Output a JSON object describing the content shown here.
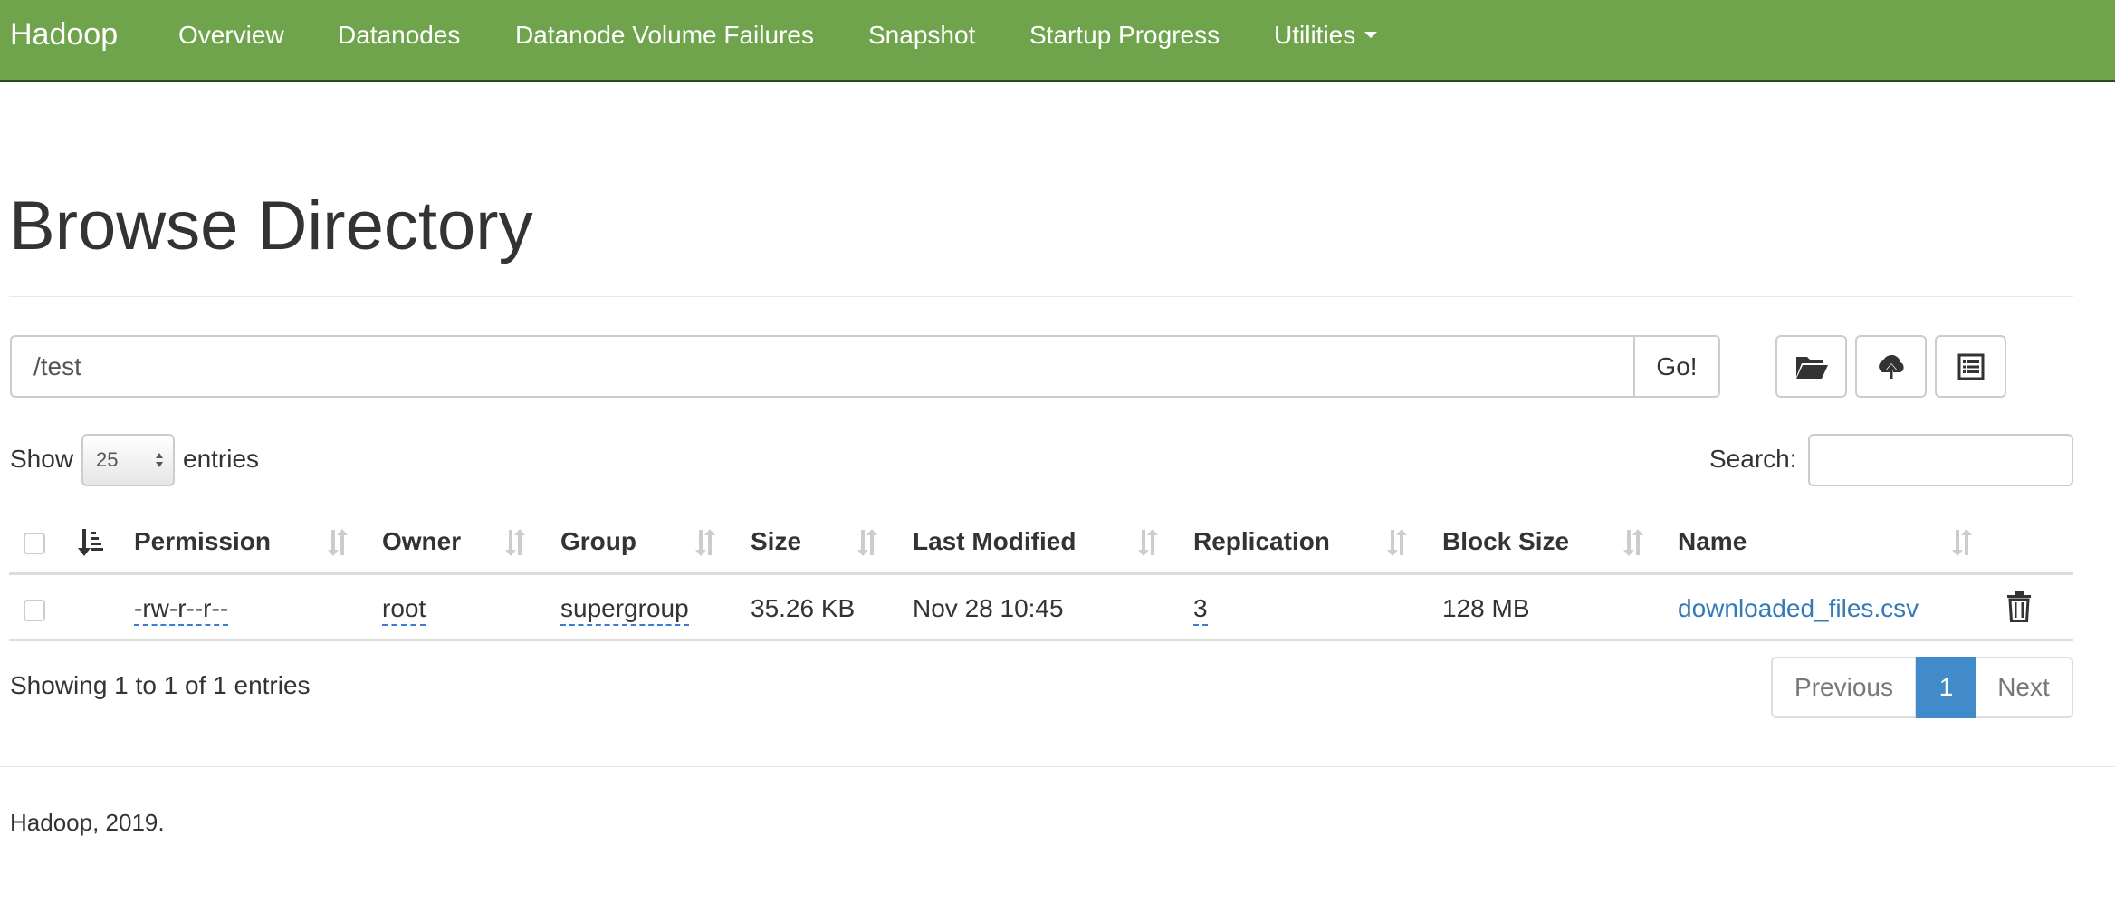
{
  "navbar": {
    "brand": "Hadoop",
    "items": [
      {
        "label": "Overview"
      },
      {
        "label": "Datanodes"
      },
      {
        "label": "Datanode Volume Failures"
      },
      {
        "label": "Snapshot"
      },
      {
        "label": "Startup Progress"
      },
      {
        "label": "Utilities"
      }
    ],
    "background_color": "#6fa44c"
  },
  "page": {
    "title": "Browse Directory"
  },
  "path_bar": {
    "value": "/test",
    "go_label": "Go!",
    "tool_icons": [
      "folder-open-icon",
      "cloud-upload-icon",
      "list-alt-icon"
    ]
  },
  "table_controls": {
    "show_label": "Show",
    "page_length": "25",
    "entries_label": "entries",
    "search_label": "Search:",
    "search_value": ""
  },
  "table": {
    "columns": [
      "Permission",
      "Owner",
      "Group",
      "Size",
      "Last Modified",
      "Replication",
      "Block Size",
      "Name"
    ],
    "rows": [
      {
        "permission": "-rw-r--r--",
        "owner": "root",
        "group": "supergroup",
        "size": "35.26 KB",
        "last_modified": "Nov 28 10:45",
        "replication": "3",
        "block_size": "128 MB",
        "name": "downloaded_files.csv"
      }
    ]
  },
  "pagination": {
    "info": "Showing 1 to 1 of 1 entries",
    "previous_label": "Previous",
    "current_page": "1",
    "next_label": "Next",
    "active_color": "#428bca"
  },
  "footer": {
    "text": "Hadoop, 2019."
  }
}
